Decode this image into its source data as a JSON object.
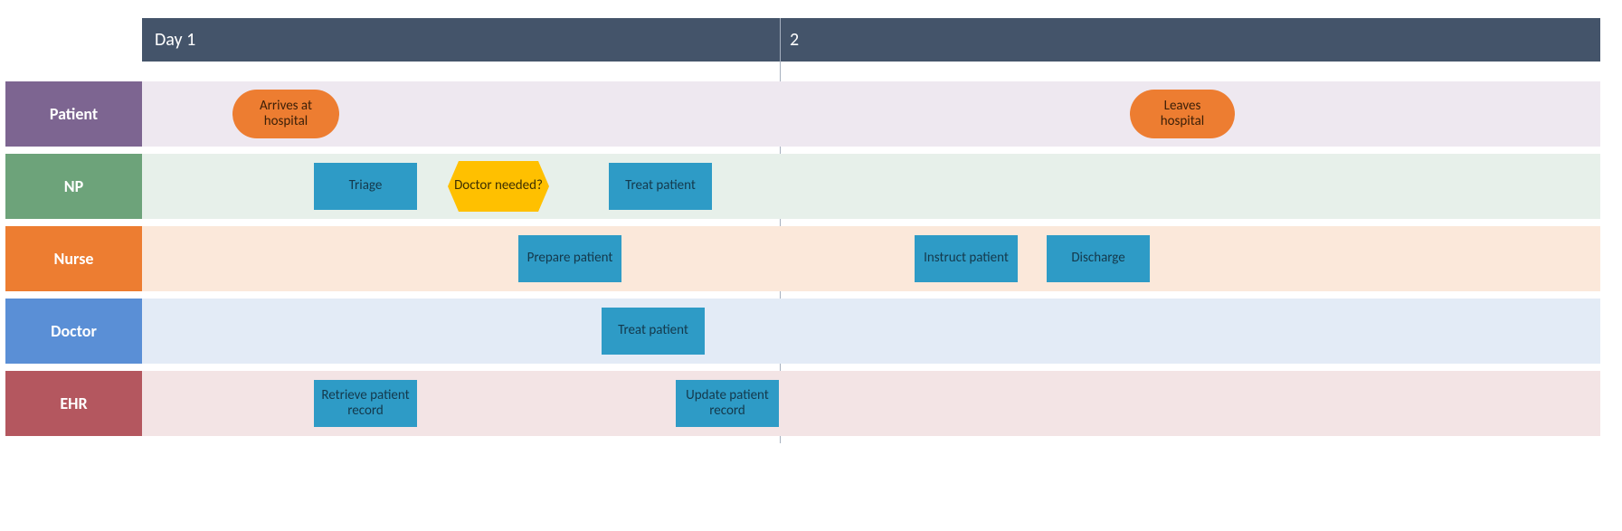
{
  "timeline": {
    "day1_label": "Day 1",
    "day2_label": "2"
  },
  "lanes": {
    "patient": {
      "label": "Patient"
    },
    "np": {
      "label": "NP"
    },
    "nurse": {
      "label": "Nurse"
    },
    "doctor": {
      "label": "Doctor"
    },
    "ehr": {
      "label": "EHR"
    }
  },
  "activities": {
    "arrives": "Arrives\nat hospital",
    "leaves": "Leaves\nhospital",
    "triage": "Triage",
    "doctor_needed": "Doctor\nneeded?",
    "treat_patient_np": "Treat\npatient",
    "prepare_patient": "Prepare\npatient",
    "instruct_patient": "Instruct\npatient",
    "discharge": "Discharge",
    "treat_patient_doctor": "Treat\npatient",
    "retrieve_record": "Retrieve\npatient record",
    "update_record": "Update\npatient record"
  },
  "colors": {
    "header_bg": "#44546a",
    "activity_bg": "#2e9bc6",
    "terminator_bg": "#ed7d31",
    "decision_bg": "#ffc000",
    "lane_patient": "#7d6591",
    "lane_np": "#6da37a",
    "lane_nurse": "#ed7d31",
    "lane_doctor": "#5a8fd6",
    "lane_ehr": "#b4575f"
  }
}
